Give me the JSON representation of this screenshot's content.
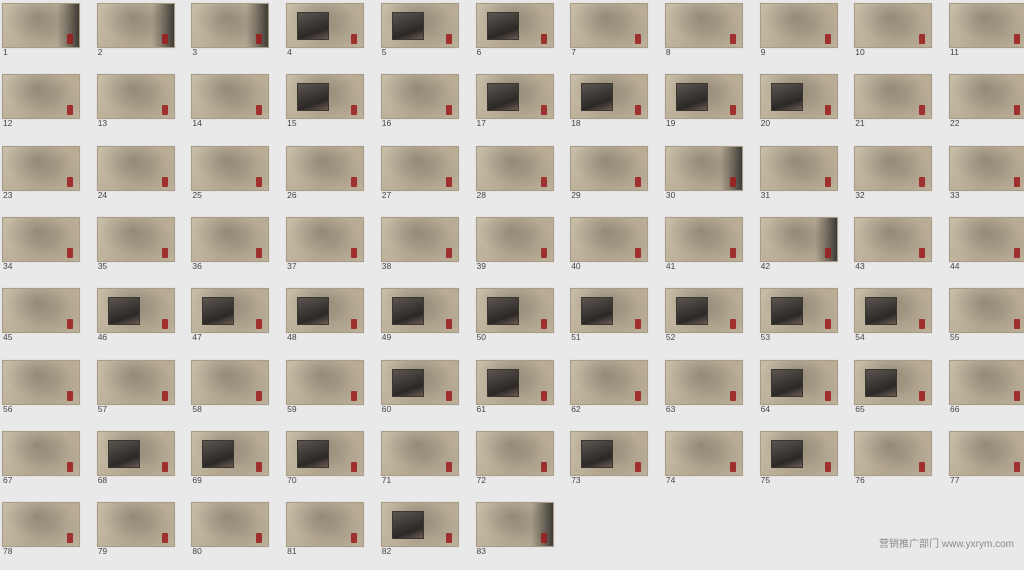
{
  "slides": [
    "1",
    "2",
    "3",
    "4",
    "5",
    "6",
    "7",
    "8",
    "9",
    "10",
    "11",
    "12",
    "13",
    "14",
    "15",
    "16",
    "17",
    "18",
    "19",
    "20",
    "21",
    "22",
    "23",
    "24",
    "25",
    "26",
    "27",
    "28",
    "29",
    "30",
    "31",
    "32",
    "33",
    "34",
    "35",
    "36",
    "37",
    "38",
    "39",
    "40",
    "41",
    "42",
    "43",
    "44",
    "45",
    "46",
    "47",
    "48",
    "49",
    "50",
    "51",
    "52",
    "53",
    "54",
    "55",
    "56",
    "57",
    "58",
    "59",
    "60",
    "61",
    "62",
    "63",
    "64",
    "65",
    "66",
    "67",
    "68",
    "69",
    "70",
    "71",
    "72",
    "73",
    "74",
    "75",
    "76",
    "77",
    "78",
    "79",
    "80",
    "81",
    "82",
    "83"
  ],
  "watermark": "营销推广部门 www.yxrym.com"
}
